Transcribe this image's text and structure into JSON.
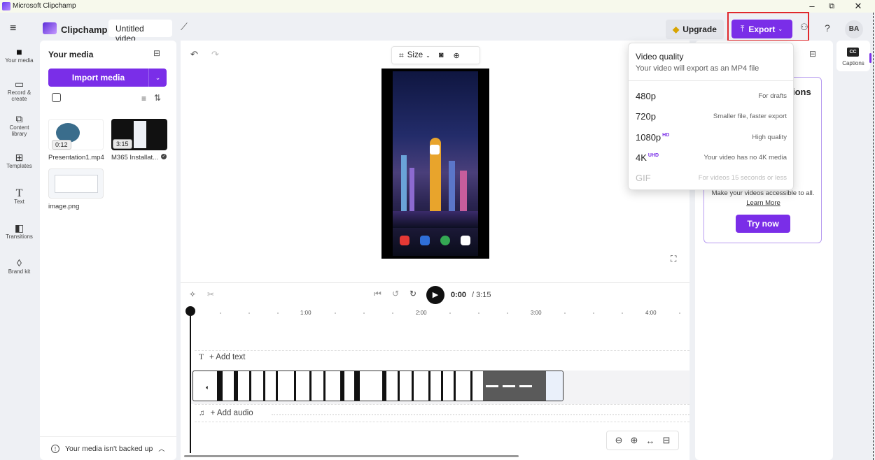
{
  "window": {
    "title": "Microsoft Clipchamp",
    "controls": {
      "minimize": "–",
      "restore": "⧉",
      "close": "✕"
    }
  },
  "appbar": {
    "brand": "Clipchamp",
    "project_title": "Untitled video",
    "upgrade_label": "Upgrade",
    "export_label": "Export",
    "help": "?",
    "avatar": "BA"
  },
  "sidebar": {
    "items": [
      {
        "label": "Your media",
        "icon": "folder-icon"
      },
      {
        "label": "Record & create",
        "icon": "camera-icon"
      },
      {
        "label": "Content library",
        "icon": "library-icon"
      },
      {
        "label": "Templates",
        "icon": "templates-icon"
      },
      {
        "label": "Text",
        "icon": "text-icon"
      },
      {
        "label": "Transitions",
        "icon": "transitions-icon"
      },
      {
        "label": "Brand kit",
        "icon": "brand-kit-icon"
      }
    ]
  },
  "media": {
    "title": "Your media",
    "import_label": "Import media",
    "items": [
      {
        "name": "Presentation1.mp4",
        "duration": "0:12"
      },
      {
        "name": "M365 Installat...",
        "duration": "3:15"
      },
      {
        "name": "image.png",
        "duration": ""
      }
    ],
    "backup_notice": "Your media isn't backed up"
  },
  "stage": {
    "size_label": "Size"
  },
  "playback": {
    "current": "0:00",
    "total": "/ 3:15"
  },
  "timeline": {
    "ticks": [
      "1:00",
      "2:00",
      "3:00",
      "4:00"
    ],
    "add_text": "+ Add text",
    "add_audio": "+ Add audio"
  },
  "export_menu": {
    "heading": "Video quality",
    "subheading": "Your video will export as an MP4 file",
    "options": [
      {
        "label": "480p",
        "badge": "",
        "desc": "For drafts",
        "disabled": false
      },
      {
        "label": "720p",
        "badge": "",
        "desc": "Smaller file, faster export",
        "disabled": false
      },
      {
        "label": "1080p",
        "badge": "HD",
        "desc": "High quality",
        "disabled": false
      },
      {
        "label": "4K",
        "badge": "UHD",
        "desc": "Your video has no 4K media",
        "disabled": false
      },
      {
        "label": "GIF",
        "badge": "",
        "desc": "For videos 15 seconds or less",
        "disabled": true
      }
    ]
  },
  "right_panel": {
    "partial_title": "ions",
    "description": "Make your videos accessible to all.",
    "learn_more": "Learn More",
    "try_now": "Try now"
  },
  "captions_tab": {
    "badge": "CC",
    "label": "Captions"
  },
  "colors": {
    "accent": "#7a2ee8",
    "highlight_border": "#e0282c"
  }
}
